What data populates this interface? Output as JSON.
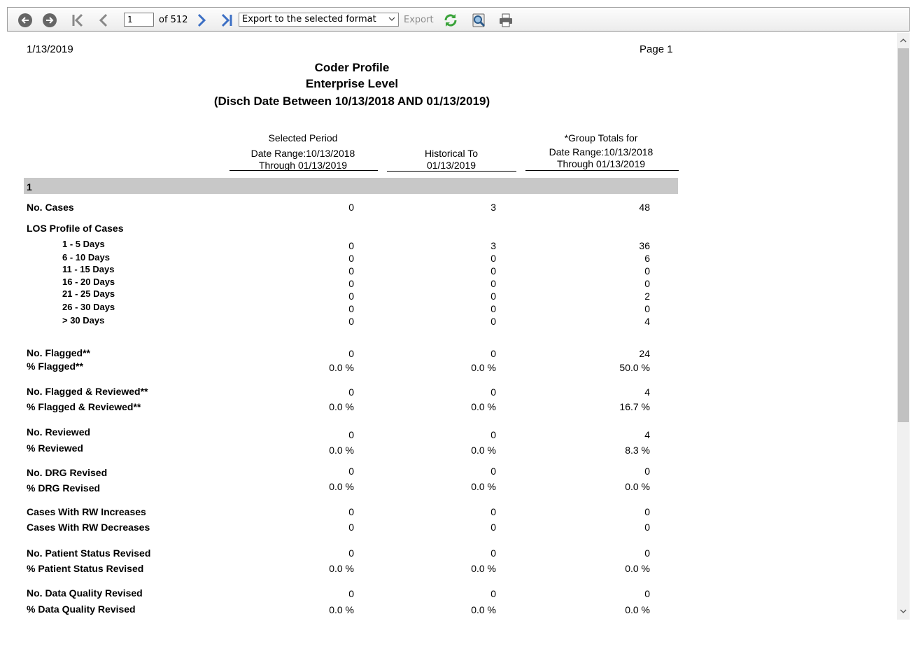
{
  "toolbar": {
    "page_value": "1",
    "page_count_text": "of 512",
    "format_select": "Export to the selected format",
    "export_label": "Export",
    "icons": [
      "back-icon",
      "forward-icon",
      "first-page-icon",
      "previous-page-icon",
      "next-page-icon",
      "last-page-icon",
      "refresh-icon",
      "find-icon",
      "print-icon"
    ]
  },
  "report": {
    "date": "1/13/2019",
    "page": "Page 1",
    "title_lines": [
      "Coder Profile",
      "Enterprise Level",
      "(Disch Date Between 10/13/2018 AND 01/13/2019)"
    ],
    "columns": [
      [
        "Selected Period",
        "Date Range:10/13/2018",
        "Through 01/13/2019"
      ],
      [
        "Historical To",
        "01/13/2019"
      ],
      [
        "*Group Totals for",
        "Date Range:10/13/2018",
        "Through 01/13/2019"
      ]
    ],
    "group": "1",
    "rows": [
      {
        "label": "No. Cases",
        "vals": [
          "0",
          "3",
          "48"
        ]
      },
      {
        "label": "LOS Profile of Cases",
        "vals": [
          "",
          "",
          ""
        ]
      },
      {
        "label": "1 - 5 Days",
        "vals": [
          "0",
          "3",
          "36"
        ]
      },
      {
        "label": "6 - 10 Days",
        "vals": [
          "0",
          "0",
          "6"
        ]
      },
      {
        "label": "11 - 15 Days",
        "vals": [
          "0",
          "0",
          "0"
        ]
      },
      {
        "label": "16 - 20 Days",
        "vals": [
          "0",
          "0",
          "0"
        ]
      },
      {
        "label": "21 - 25 Days",
        "vals": [
          "0",
          "0",
          "2"
        ]
      },
      {
        "label": "26 - 30 Days",
        "vals": [
          "0",
          "0",
          "0"
        ]
      },
      {
        "label": "> 30 Days",
        "vals": [
          "0",
          "0",
          "4"
        ]
      },
      {
        "label": "No. Flagged**",
        "vals": [
          "0",
          "0",
          "24"
        ]
      },
      {
        "label": "% Flagged**",
        "vals": [
          "0.0 %",
          "0.0 %",
          "50.0 %"
        ]
      },
      {
        "label": "No. Flagged & Reviewed**",
        "vals": [
          "0",
          "0",
          "4"
        ]
      },
      {
        "label": "% Flagged & Reviewed**",
        "vals": [
          "0.0 %",
          "0.0 %",
          "16.7 %"
        ]
      },
      {
        "label": "No. Reviewed",
        "vals": [
          "0",
          "0",
          "4"
        ]
      },
      {
        "label": "% Reviewed",
        "vals": [
          "0.0 %",
          "0.0 %",
          "8.3 %"
        ]
      },
      {
        "label": "No. DRG Revised",
        "vals": [
          "0",
          "0",
          "0"
        ]
      },
      {
        "label": "% DRG Revised",
        "vals": [
          "0.0 %",
          "0.0 %",
          "0.0 %"
        ]
      },
      {
        "label": "Cases With RW Increases",
        "vals": [
          "0",
          "0",
          "0"
        ]
      },
      {
        "label": "Cases With RW Decreases",
        "vals": [
          "0",
          "0",
          "0"
        ]
      },
      {
        "label": "No. Patient Status Revised",
        "vals": [
          "0",
          "0",
          "0"
        ]
      },
      {
        "label": "% Patient Status Revised",
        "vals": [
          "0.0 %",
          "0.0 %",
          "0.0 %"
        ]
      },
      {
        "label": "No. Data Quality Revised",
        "vals": [
          "0",
          "0",
          "0"
        ]
      },
      {
        "label": "% Data Quality Revised",
        "vals": [
          "0.0 %",
          "0.0 %",
          "0.0 %"
        ]
      }
    ]
  }
}
